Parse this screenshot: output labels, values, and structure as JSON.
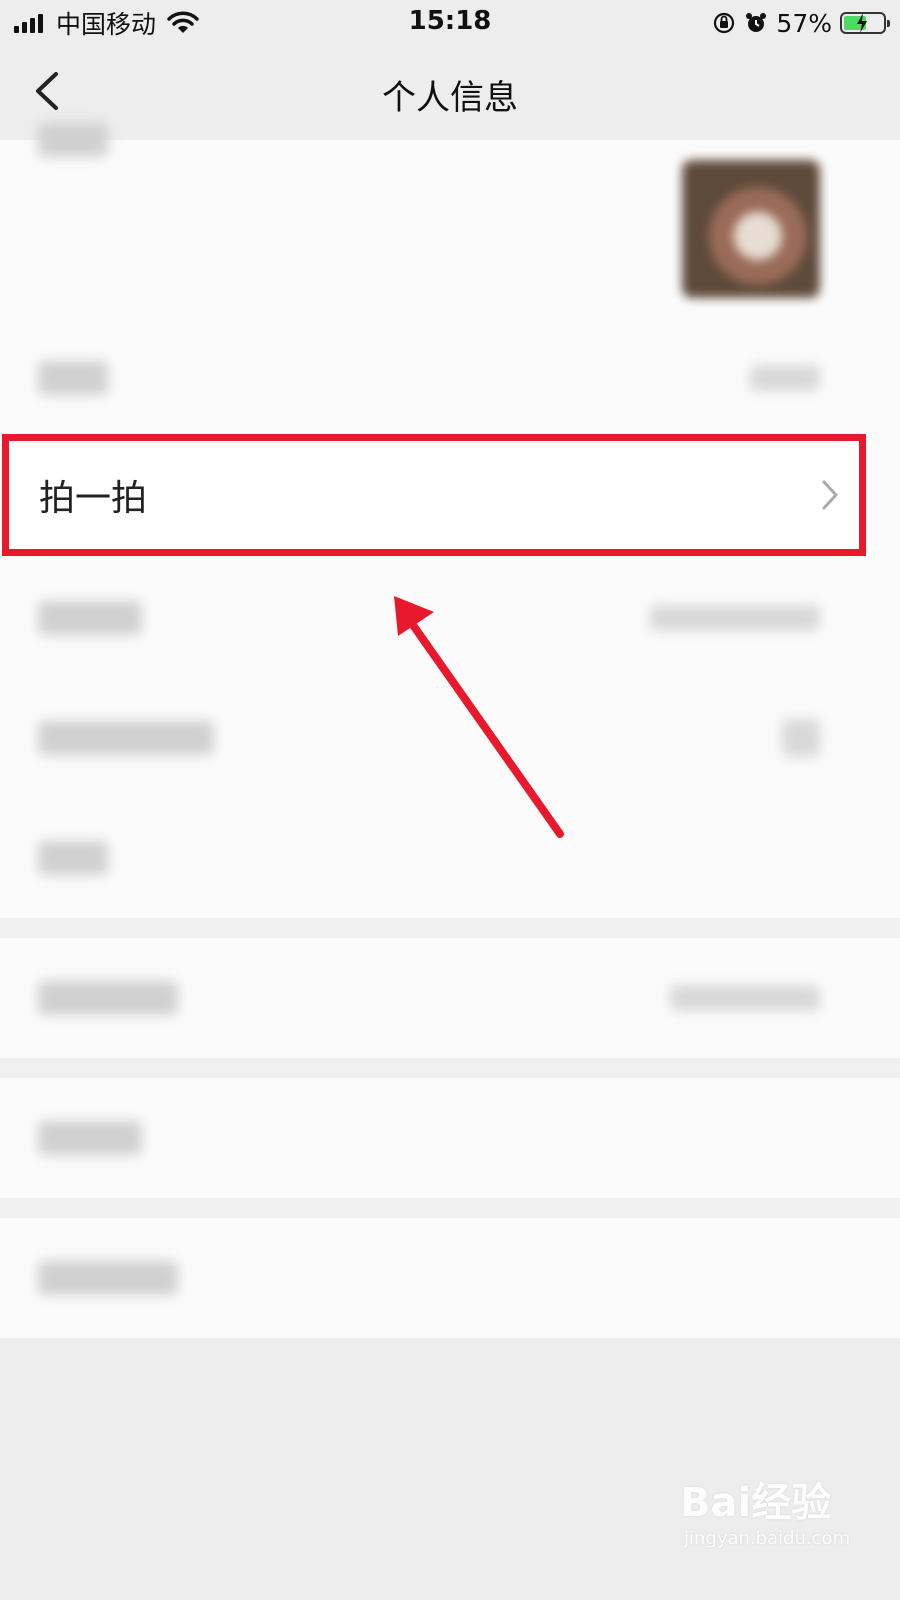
{
  "status": {
    "carrier": "中国移动",
    "time": "15:18",
    "battery": "57%",
    "battery_level": 0.57
  },
  "nav": {
    "title": "个人信息"
  },
  "highlighted_item": {
    "label": "拍一拍"
  },
  "watermark": {
    "logo": "Bai经验",
    "url": "jingyan.baidu.com"
  },
  "colors": {
    "highlight": "#e8192c",
    "background": "#ededed"
  }
}
